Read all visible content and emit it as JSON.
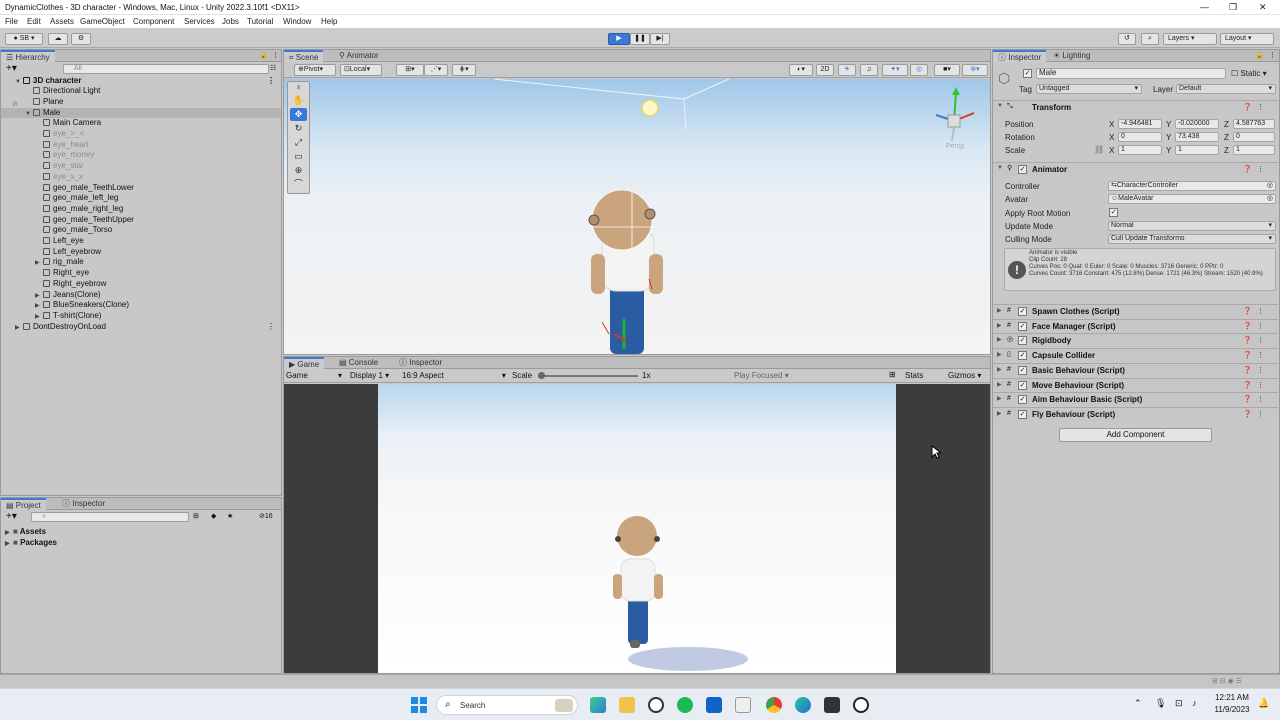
{
  "window": {
    "title": "DynamicClothes - 3D character - Windows, Mac, Linux - Unity 2022.3.10f1 <DX11>"
  },
  "menu": [
    "File",
    "Edit",
    "Assets",
    "GameObject",
    "Component",
    "Services",
    "Jobs",
    "Tutorial",
    "Window",
    "Help"
  ],
  "toolbar": {
    "account": "SB",
    "layers": "Layers",
    "layout": "Layout"
  },
  "hierarchy": {
    "tab": "Hierarchy",
    "search_placeholder": "All",
    "items": [
      {
        "label": "3D character",
        "depth": 0,
        "arrow": "▼",
        "bold": true,
        "dim": false,
        "sel": false
      },
      {
        "label": "Directional Light",
        "depth": 1,
        "arrow": "",
        "bold": false,
        "dim": false,
        "sel": false
      },
      {
        "label": "Plane",
        "depth": 1,
        "arrow": "",
        "bold": false,
        "dim": false,
        "sel": false
      },
      {
        "label": "Male",
        "depth": 1,
        "arrow": "▼",
        "bold": false,
        "dim": false,
        "sel": true
      },
      {
        "label": "Main Camera",
        "depth": 2,
        "arrow": "",
        "bold": false,
        "dim": false,
        "sel": false
      },
      {
        "label": "eye_>_<",
        "depth": 2,
        "arrow": "",
        "bold": false,
        "dim": true,
        "sel": false
      },
      {
        "label": "eye_heart",
        "depth": 2,
        "arrow": "",
        "bold": false,
        "dim": true,
        "sel": false
      },
      {
        "label": "eye_money",
        "depth": 2,
        "arrow": "",
        "bold": false,
        "dim": true,
        "sel": false
      },
      {
        "label": "eye_star",
        "depth": 2,
        "arrow": "",
        "bold": false,
        "dim": true,
        "sel": false
      },
      {
        "label": "eye_x_x",
        "depth": 2,
        "arrow": "",
        "bold": false,
        "dim": true,
        "sel": false
      },
      {
        "label": "geo_male_TeethLower",
        "depth": 2,
        "arrow": "",
        "bold": false,
        "dim": false,
        "sel": false
      },
      {
        "label": "geo_male_left_leg",
        "depth": 2,
        "arrow": "",
        "bold": false,
        "dim": false,
        "sel": false
      },
      {
        "label": "geo_male_right_leg",
        "depth": 2,
        "arrow": "",
        "bold": false,
        "dim": false,
        "sel": false
      },
      {
        "label": "geo_male_TeethUpper",
        "depth": 2,
        "arrow": "",
        "bold": false,
        "dim": false,
        "sel": false
      },
      {
        "label": "geo_male_Torso",
        "depth": 2,
        "arrow": "",
        "bold": false,
        "dim": false,
        "sel": false
      },
      {
        "label": "Left_eye",
        "depth": 2,
        "arrow": "",
        "bold": false,
        "dim": false,
        "sel": false
      },
      {
        "label": "Left_eyebrow",
        "depth": 2,
        "arrow": "",
        "bold": false,
        "dim": false,
        "sel": false
      },
      {
        "label": "rig_male",
        "depth": 2,
        "arrow": "▶",
        "bold": false,
        "dim": false,
        "sel": false
      },
      {
        "label": "Right_eye",
        "depth": 2,
        "arrow": "",
        "bold": false,
        "dim": false,
        "sel": false
      },
      {
        "label": "Right_eyebrow",
        "depth": 2,
        "arrow": "",
        "bold": false,
        "dim": false,
        "sel": false
      },
      {
        "label": "Jeans(Clone)",
        "depth": 2,
        "arrow": "▶",
        "bold": false,
        "dim": false,
        "sel": false
      },
      {
        "label": "BlueSneakers(Clone)",
        "depth": 2,
        "arrow": "▶",
        "bold": false,
        "dim": false,
        "sel": false
      },
      {
        "label": "T-shirt(Clone)",
        "depth": 2,
        "arrow": "▶",
        "bold": false,
        "dim": false,
        "sel": false
      },
      {
        "label": "DontDestroyOnLoad",
        "depth": 0,
        "arrow": "▶",
        "bold": false,
        "dim": false,
        "sel": false
      }
    ]
  },
  "project": {
    "tabs": [
      "Project",
      "Inspector"
    ],
    "hidden_count": "16",
    "folders": [
      "Assets",
      "Packages"
    ]
  },
  "scene": {
    "tabs": [
      "Scene",
      "Animator"
    ],
    "pivot": "Pivot",
    "local": "Local",
    "mode_2d": "2D",
    "persp": "Persp"
  },
  "game": {
    "tabs": [
      "Game",
      "Console",
      "Inspector"
    ],
    "view": "Game",
    "display": "Display 1",
    "aspect": "16:9 Aspect",
    "scale_label": "Scale",
    "scale_value": "1x",
    "play_focused": "Play Focused",
    "stats": "Stats",
    "gizmos": "Gizmos",
    "scale_level": 0.0
  },
  "inspector": {
    "tabs": [
      "Inspector",
      "Lighting"
    ],
    "object_name": "Male",
    "static_label": "Static",
    "tag_label": "Tag",
    "tag_value": "Untagged",
    "layer_label": "Layer",
    "layer_value": "Default",
    "transform": {
      "title": "Transform",
      "position": {
        "label": "Position",
        "x": "-4.946481",
        "y": "-0.020000",
        "z": "4.587763"
      },
      "rotation": {
        "label": "Rotation",
        "x": "0",
        "y": "73.438",
        "z": "0"
      },
      "scale": {
        "label": "Scale",
        "x": "1",
        "y": "1",
        "z": "1"
      }
    },
    "animator": {
      "title": "Animator",
      "controller_label": "Controller",
      "controller_value": "CharacterController",
      "avatar_label": "Avatar",
      "avatar_value": "MaleAvatar",
      "root_motion_label": "Apply Root Motion",
      "update_mode_label": "Update Mode",
      "update_mode_value": "Normal",
      "culling_mode_label": "Culling Mode",
      "culling_mode_value": "Cull Update Transforms",
      "info": [
        "Animator is visible",
        "Clip Count: 28",
        "Curves Pos: 0 Quat: 0 Euler: 0 Scale: 0 Muscles: 3716 Generic: 0 PPtr: 0",
        "Curves Count: 3716 Constant: 475 (12.8%) Dense: 1721 (46.3%) Stream: 1520 (40.9%)"
      ]
    },
    "components": [
      "Spawn Clothes (Script)",
      "Face Manager (Script)",
      "Rigidbody",
      "Capsule Collider",
      "Basic Behaviour (Script)",
      "Move Behaviour (Script)",
      "Aim Behaviour Basic (Script)",
      "Fly Behaviour (Script)"
    ],
    "add_component": "Add Component"
  },
  "taskbar": {
    "search": "Search",
    "time": "12:21 AM",
    "date": "11/9/2023"
  },
  "colors": {
    "accent": "#3a79d7",
    "panel": "#c8c8c8"
  }
}
